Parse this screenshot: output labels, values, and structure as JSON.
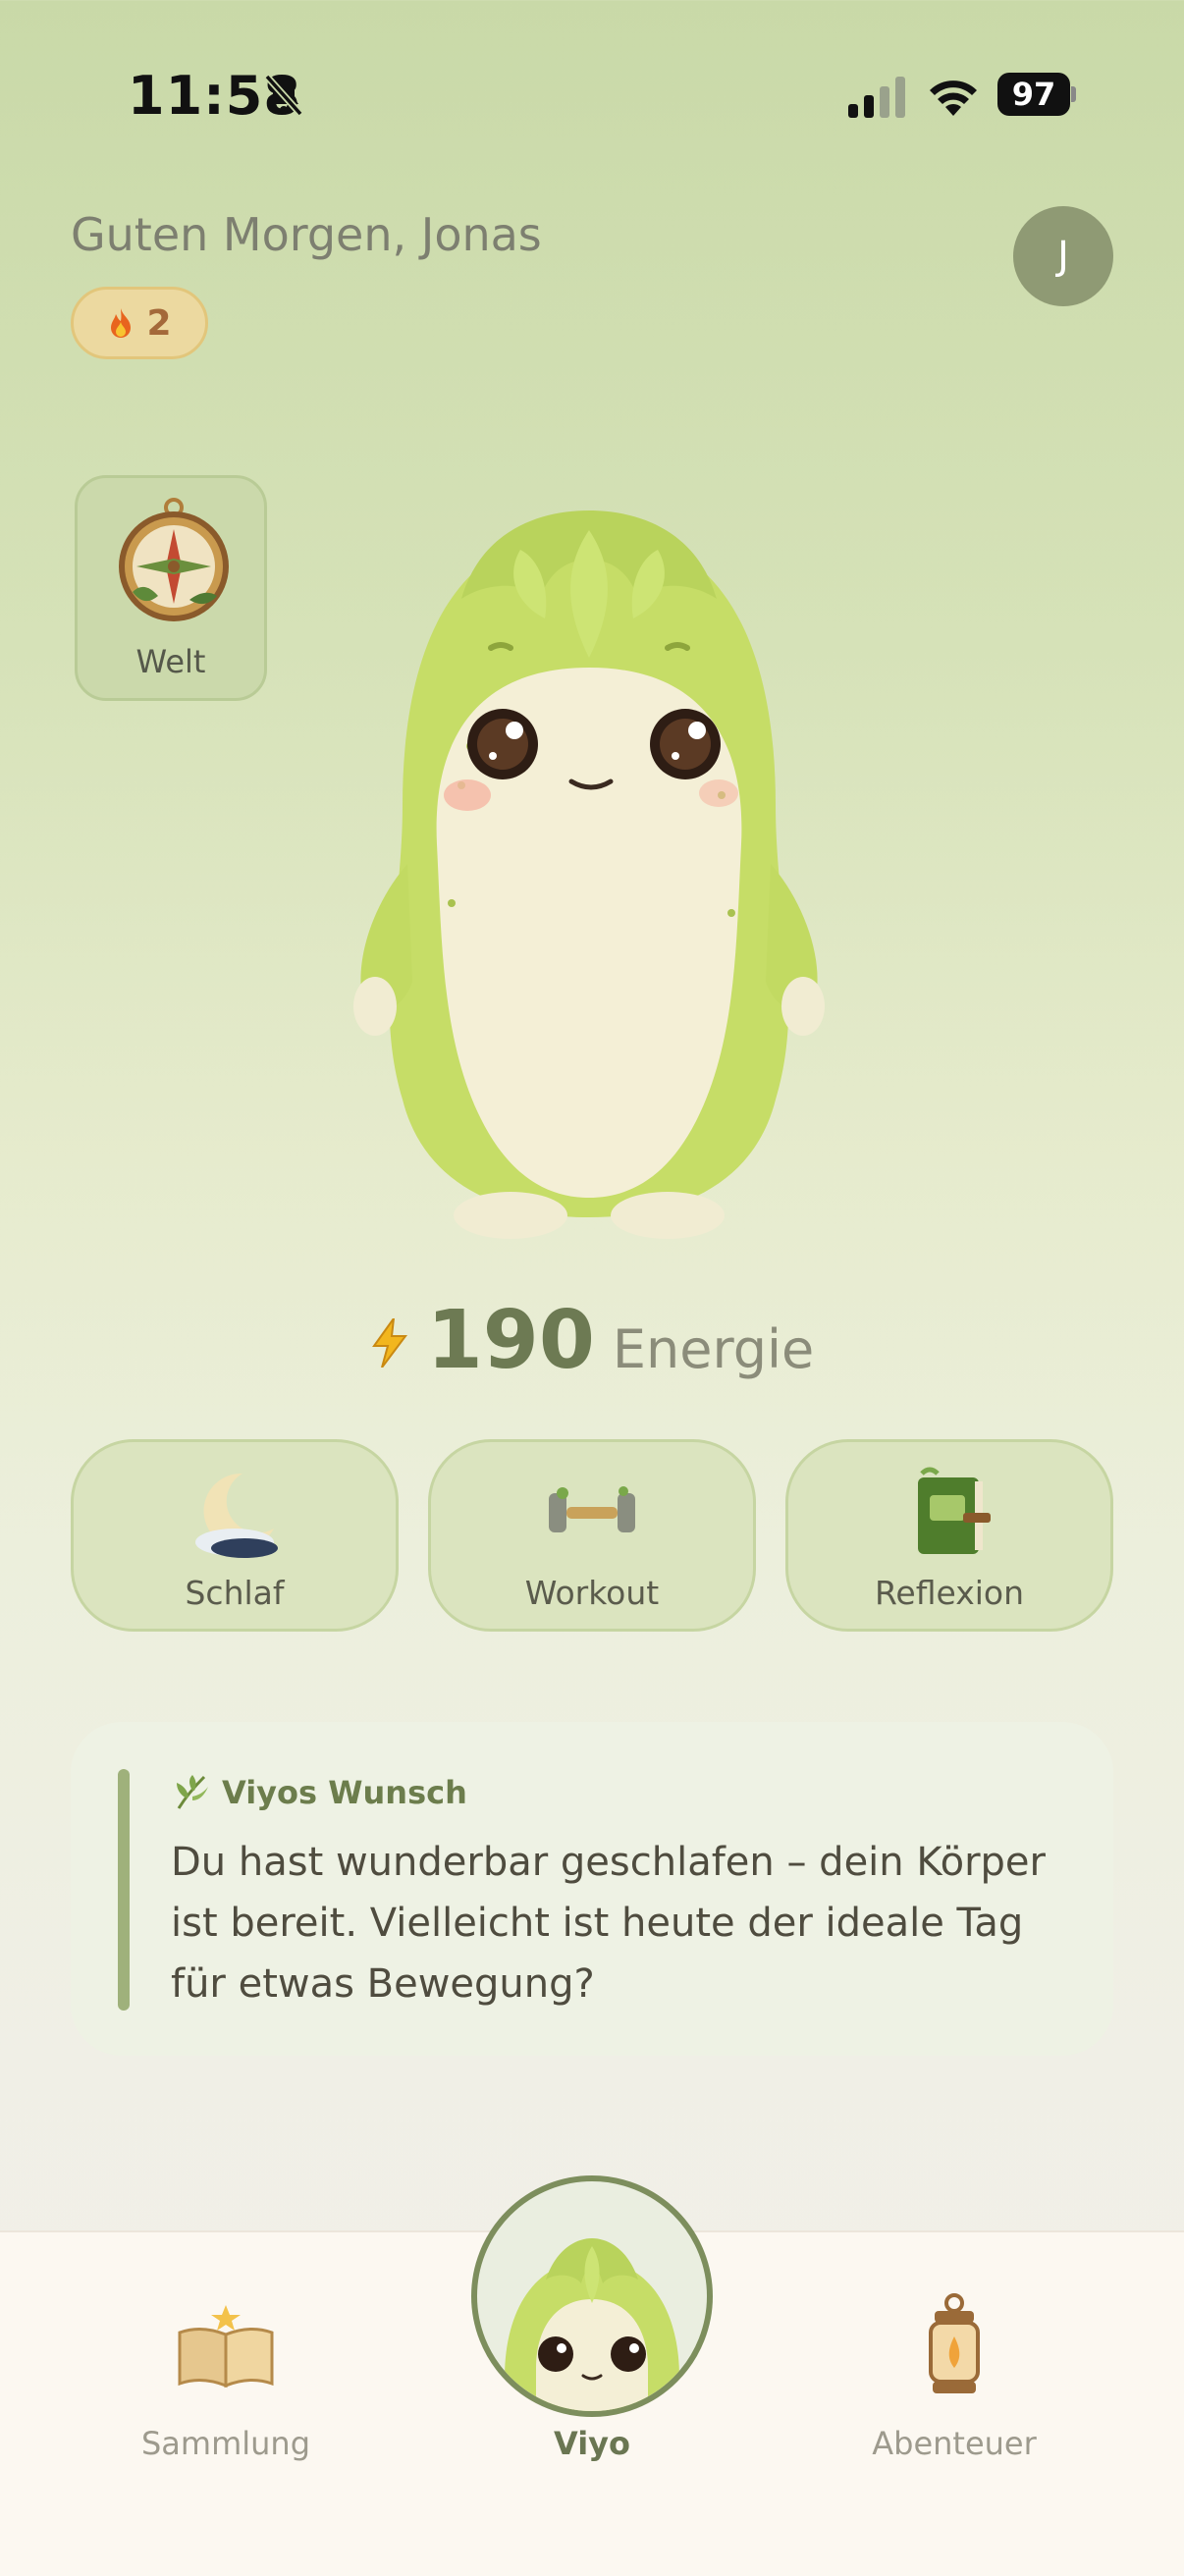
{
  "status_bar": {
    "time": "11:58",
    "battery": "97"
  },
  "header": {
    "greeting": "Guten Morgen, Jonas",
    "avatar_initial": "J",
    "streak_count": "2"
  },
  "world": {
    "label": "Welt"
  },
  "energy": {
    "value": "190",
    "label": "Energie"
  },
  "actions": [
    {
      "label": "Schlaf",
      "icon": "moon-icon"
    },
    {
      "label": "Workout",
      "icon": "dumbbell-icon"
    },
    {
      "label": "Reflexion",
      "icon": "journal-icon"
    }
  ],
  "wish": {
    "title": "Viyos Wunsch",
    "text": "Du hast wunderbar geschlafen – dein Körper ist bereit. Vielleicht ist heute der ideale Tag für etwas Bewegung?"
  },
  "nav": {
    "items": [
      {
        "label": "Sammlung",
        "icon": "open-book-icon"
      },
      {
        "label": "Viyo",
        "icon": "viyo-avatar"
      },
      {
        "label": "Abenteuer",
        "icon": "lantern-icon"
      }
    ]
  },
  "colors": {
    "accent": "#7d8e5d",
    "mascot_green": "#c8df6a",
    "mascot_belly": "#f4efd6"
  }
}
